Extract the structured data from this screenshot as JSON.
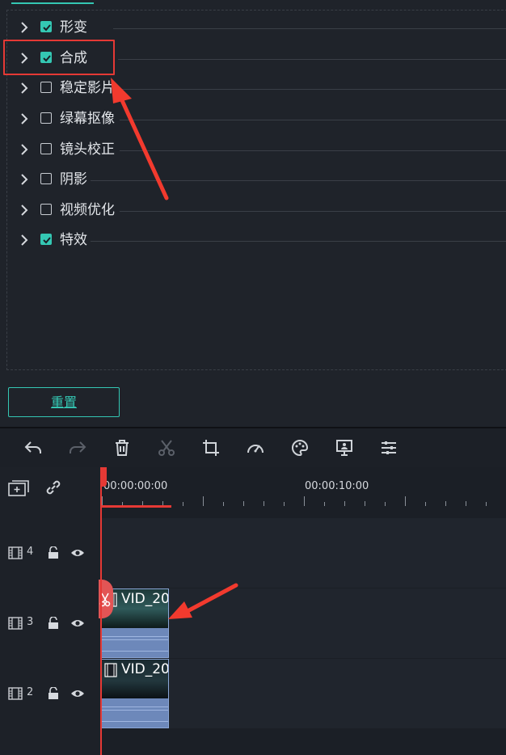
{
  "properties": {
    "items": [
      {
        "label": "形变",
        "checked": true
      },
      {
        "label": "合成",
        "checked": true
      },
      {
        "label": "稳定影片",
        "checked": false
      },
      {
        "label": "绿幕抠像",
        "checked": false
      },
      {
        "label": "镜头校正",
        "checked": false
      },
      {
        "label": "阴影",
        "checked": false
      },
      {
        "label": "视频优化",
        "checked": false
      },
      {
        "label": "特效",
        "checked": true
      }
    ],
    "reset_label": "重置"
  },
  "toolbar": {
    "icons": [
      "undo-icon",
      "redo-icon",
      "delete-icon",
      "cut-icon",
      "crop-icon",
      "speed-icon",
      "color-icon",
      "green-screen-icon",
      "adjust-icon"
    ]
  },
  "timeline": {
    "ruler": {
      "time_start": "00:00:00:00",
      "time_mid": "00:00:10:00"
    },
    "tracks": [
      {
        "number": "4",
        "clip": null
      },
      {
        "number": "3",
        "clip": {
          "title": "VID_20"
        }
      },
      {
        "number": "2",
        "clip": {
          "title": "VID_20"
        }
      }
    ]
  },
  "colors": {
    "accent": "#34c7b3",
    "highlight": "#e53935",
    "clip": "#6b86b8"
  }
}
